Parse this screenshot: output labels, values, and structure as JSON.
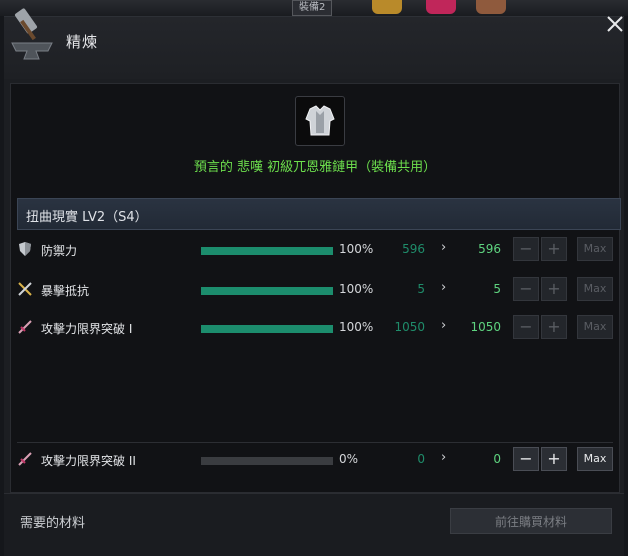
{
  "top_strip": {
    "tab_label": "裝備2"
  },
  "window": {
    "title": "精煉"
  },
  "item": {
    "icon": "armor-icon",
    "name": "預言的 悲嘆 初級兀恩雅鏈甲（裝備共用）",
    "name_color": "#6ddf4d"
  },
  "section": {
    "label": "扭曲現實 LV2（S4）"
  },
  "stats": [
    {
      "label": "防禦力",
      "icon": "shield-icon",
      "fill": 1.0,
      "percent": "100%",
      "current": "596",
      "next": "596",
      "minus": "−",
      "plus": "+",
      "max": "Max"
    },
    {
      "label": "暴擊抵抗",
      "icon": "crossed-swords-icon",
      "fill": 1.0,
      "percent": "100%",
      "current": "5",
      "next": "5",
      "minus": "−",
      "plus": "+",
      "max": "Max"
    },
    {
      "label": "攻擊力限界突破 I",
      "icon": "sword-icon",
      "fill": 1.0,
      "percent": "100%",
      "current": "1050",
      "next": "1050",
      "minus": "−",
      "plus": "+",
      "max": "Max"
    }
  ],
  "extra_stat": {
    "label": "攻擊力限界突破 II",
    "icon": "sword-icon",
    "fill": 0.0,
    "percent": "0%",
    "current": "0",
    "next": "0",
    "minus": "−",
    "plus": "+",
    "max": "Max"
  },
  "footer": {
    "label": "需要的材料",
    "buy_button": "前往購買材料"
  },
  "colors": {
    "bar_fill": "#1c8d6d",
    "current_value": "#1f8c6a",
    "next_value": "#5ed37f"
  }
}
